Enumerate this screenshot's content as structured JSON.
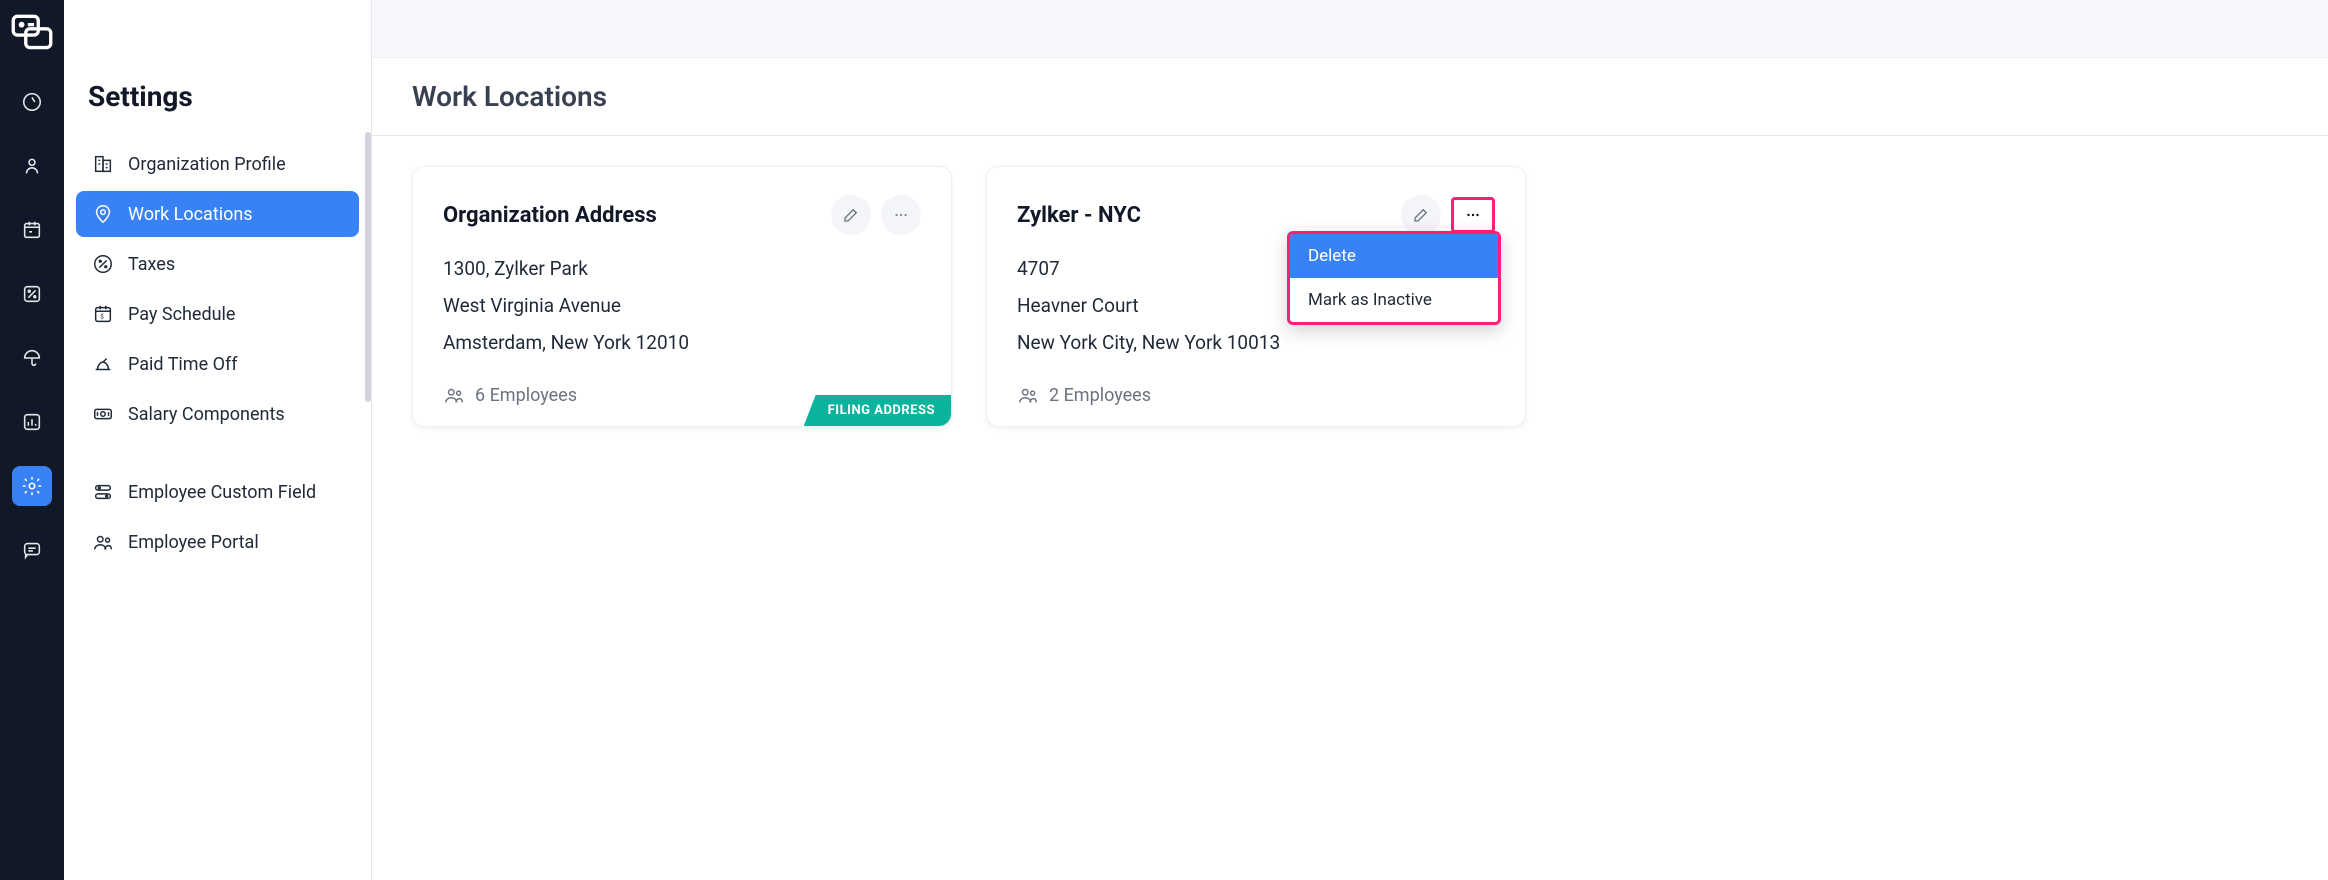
{
  "settingsTitle": "Settings",
  "nav": {
    "items": [
      {
        "label": "Organization Profile"
      },
      {
        "label": "Work Locations"
      },
      {
        "label": "Taxes"
      },
      {
        "label": "Pay Schedule"
      },
      {
        "label": "Paid Time Off"
      },
      {
        "label": "Salary Components"
      },
      {
        "label": "Employee Custom Field"
      },
      {
        "label": "Employee Portal"
      }
    ]
  },
  "page": {
    "title": "Work Locations"
  },
  "cards": [
    {
      "title": "Organization Address",
      "line1": "1300, Zylker Park",
      "line2": "West Virginia Avenue",
      "line3": "Amsterdam, New York 12010",
      "employees": "6 Employees",
      "filingBadge": "FILING ADDRESS"
    },
    {
      "title": "Zylker - NYC",
      "line1": "4707",
      "line2": "Heavner Court",
      "line3": "New York City, New York 10013",
      "employees": "2 Employees"
    }
  ],
  "dropdown": {
    "delete": "Delete",
    "markInactive": "Mark as Inactive"
  }
}
